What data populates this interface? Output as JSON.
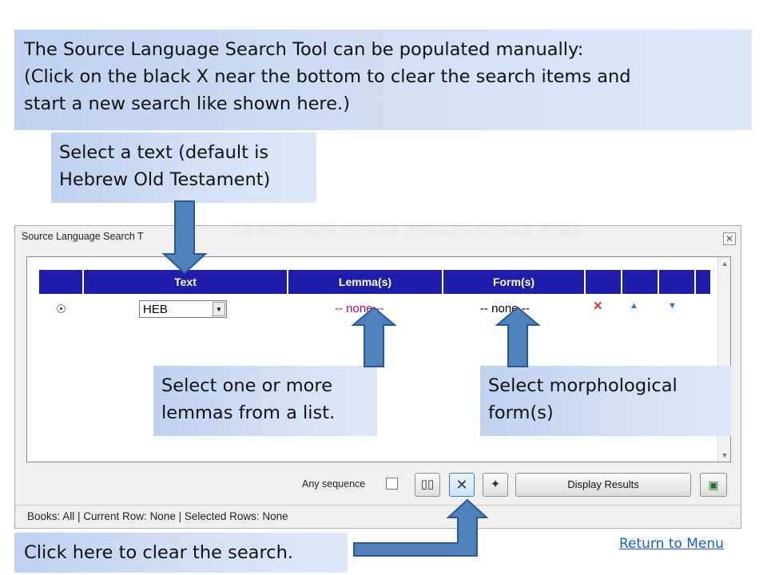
{
  "callouts": {
    "top": {
      "line1": "The Source Language Search Tool can be populated manually:",
      "line2": "(Click on the black X near the bottom to clear the search items and",
      "line3": "start a new search like shown here.)"
    },
    "text": {
      "line1": "Select a text (default is",
      "line2": "Hebrew Old Testament)"
    },
    "lemma": {
      "line1": "Select one or more",
      "line2": "lemmas from a list."
    },
    "form": {
      "line1": "Select morphological",
      "line2": "form(s)"
    },
    "clear": {
      "line1": "Click here to clear the search."
    }
  },
  "window": {
    "title": "Source Language Search T",
    "close_icon": "close-icon",
    "columns": [
      "",
      "Text",
      "Lemma(s)",
      "Form(s)",
      "",
      "",
      "",
      ""
    ],
    "row": {
      "text_value": "HEB",
      "lemma_value": "-- none --",
      "form_value": "-- none --"
    },
    "toolbar": {
      "any_sequence_label": "Any sequence",
      "display_results_label": "Display Results",
      "clear_glyph": "✕"
    },
    "status": "Books: All | Current Row: None | Selected Rows: None"
  },
  "return_link": "Return to Menu",
  "colors": {
    "header_blue": "#1e1eab",
    "callout_blue": "#c8d8f2",
    "arrow_fill": "#4f81bd",
    "arrow_stroke": "#2c5a8f",
    "lemma_text": "#b5006f",
    "link": "#1a5bd6"
  }
}
